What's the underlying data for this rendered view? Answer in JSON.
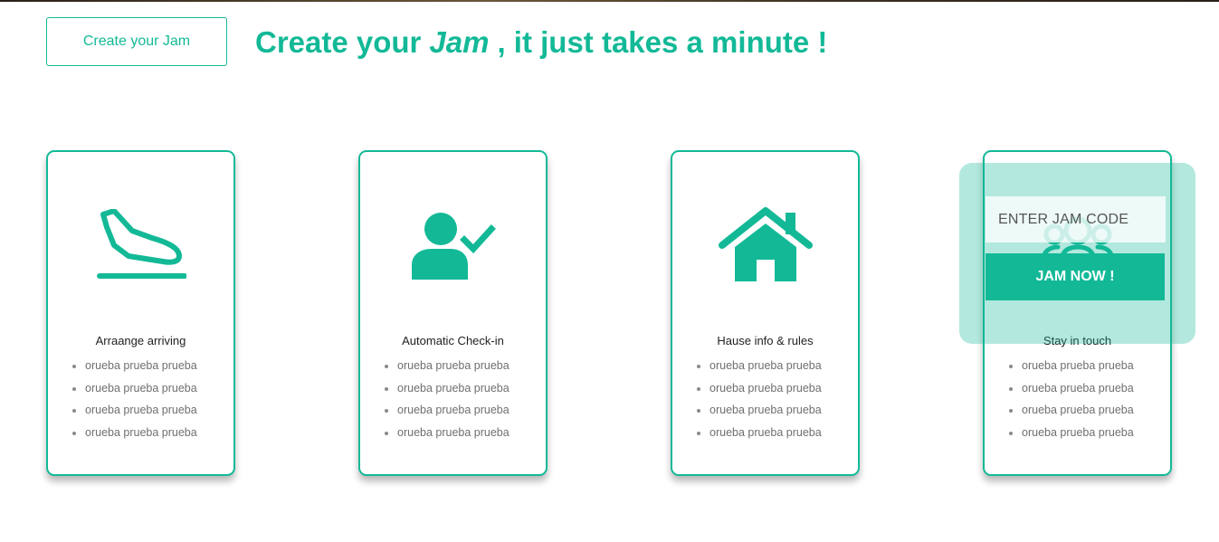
{
  "header": {
    "create_button_label": "Create your Jam",
    "headline_prefix": "Create your",
    "headline_emphasis": "Jam",
    "headline_suffix": ", it just takes a minute !"
  },
  "cards": [
    {
      "icon": "plane-landing-icon",
      "title": "Arraange arriving",
      "items": [
        "orueba prueba prueba",
        "orueba prueba prueba",
        "orueba prueba prueba",
        "orueba prueba prueba"
      ]
    },
    {
      "icon": "user-check-icon",
      "title": "Automatic Check-in",
      "items": [
        "orueba prueba prueba",
        "orueba prueba prueba",
        "orueba prueba prueba",
        "orueba prueba prueba"
      ]
    },
    {
      "icon": "home-icon",
      "title": "Hause info & rules",
      "items": [
        "orueba prueba prueba",
        "orueba prueba prueba",
        "orueba prueba prueba",
        "orueba prueba prueba"
      ]
    },
    {
      "icon": "group-icon",
      "title": "Stay in touch",
      "items": [
        "orueba prueba prueba",
        "orueba prueba prueba",
        "orueba prueba prueba",
        "orueba prueba prueba"
      ]
    }
  ],
  "jam_code": {
    "placeholder": "ENTER JAM CODE",
    "value": "",
    "button_label": "JAM NOW !"
  },
  "colors": {
    "accent": "#13b997",
    "overlay": "#b3e9dd"
  }
}
